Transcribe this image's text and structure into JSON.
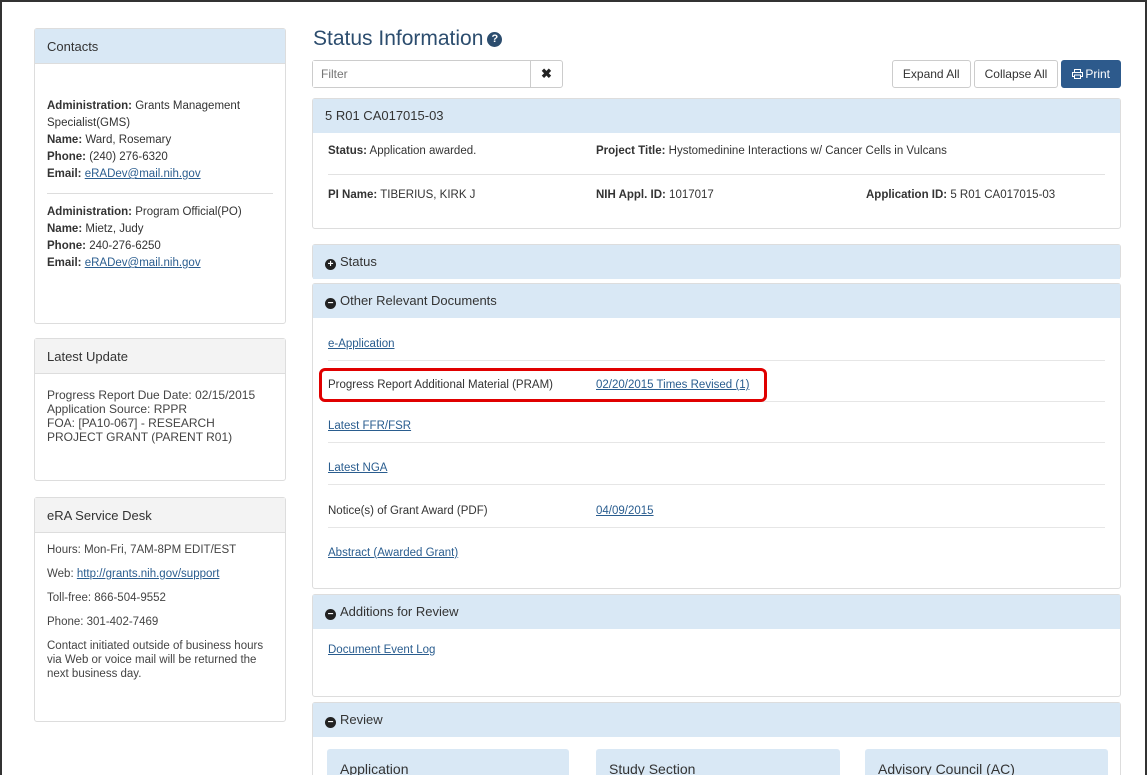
{
  "contacts": {
    "title": "Contacts",
    "people": [
      {
        "admin_label": "Administration:",
        "admin": "Grants Management Specialist(GMS)",
        "name_label": "Name:",
        "name": "Ward, Rosemary",
        "phone_label": "Phone:",
        "phone": "(240) 276-6320",
        "email_label": "Email:",
        "email": "eRADev@mail.nih.gov"
      },
      {
        "admin_label": "Administration:",
        "admin": "Program Official(PO)",
        "name_label": "Name:",
        "name": "Mietz, Judy",
        "phone_label": "Phone:",
        "phone": "240-276-6250",
        "email_label": "Email:",
        "email": "eRADev@mail.nih.gov"
      }
    ]
  },
  "latest_update": {
    "title": "Latest Update",
    "lines": [
      "Progress Report Due Date: 02/15/2015",
      "Application Source: RPPR",
      "FOA: [PA10-067] -  RESEARCH PROJECT GRANT (PARENT R01)"
    ]
  },
  "service_desk": {
    "title": "eRA Service Desk",
    "hours": "Hours: Mon-Fri, 7AM-8PM EDIT/EST",
    "web_label": "Web:",
    "web_link": "http://grants.nih.gov/support",
    "tollfree": "Toll-free: 866-504-9552",
    "phone": "Phone: 301-402-7469",
    "note": "Contact initiated outside of business hours via Web or voice mail will be returned the next business day."
  },
  "main": {
    "title": "Status Information",
    "help_glyph": "?",
    "filter_placeholder": "Filter",
    "clear_glyph": "✖",
    "expand_all": "Expand All",
    "collapse_all": "Collapse All",
    "print": "Print"
  },
  "summary": {
    "grant_number": "5 R01 CA017015-03",
    "status_label": "Status:",
    "status": "Application awarded.",
    "project_title_label": "Project Title:",
    "project_title": "Hystomedinine Interactions w/ Cancer Cells in Vulcans",
    "pi_label": "PI Name:",
    "pi": "TIBERIUS, KIRK J",
    "appl_id_label": "NIH Appl. ID:",
    "appl_id": "1017017",
    "application_id_label": "Application ID:",
    "application_id": "5 R01 CA017015-03"
  },
  "sections": {
    "status": "Status",
    "other_docs": "Other Relevant Documents",
    "additions": "Additions for Review",
    "review": "Review"
  },
  "documents": [
    {
      "label": "e-Application",
      "value": ""
    },
    {
      "label": "Progress Report Additional Material (PRAM)",
      "value": "02/20/2015 Times Revised (1)"
    },
    {
      "label": "Latest FFR/FSR",
      "value": ""
    },
    {
      "label": "Latest NGA",
      "value": ""
    },
    {
      "label": "Notice(s) of Grant Award (PDF)",
      "value": "04/09/2015"
    },
    {
      "label": "Abstract (Awarded Grant)",
      "value": ""
    }
  ],
  "additions": {
    "link": "Document Event Log"
  },
  "review_panels": [
    "Application",
    "Study Section",
    "Advisory Council (AC)"
  ],
  "colors": {
    "header_blue": "#d9e8f5",
    "title_blue": "#2c4d6e",
    "link": "#2a5d8f",
    "highlight": "#e00000",
    "print_button": "#2d5a8c"
  }
}
